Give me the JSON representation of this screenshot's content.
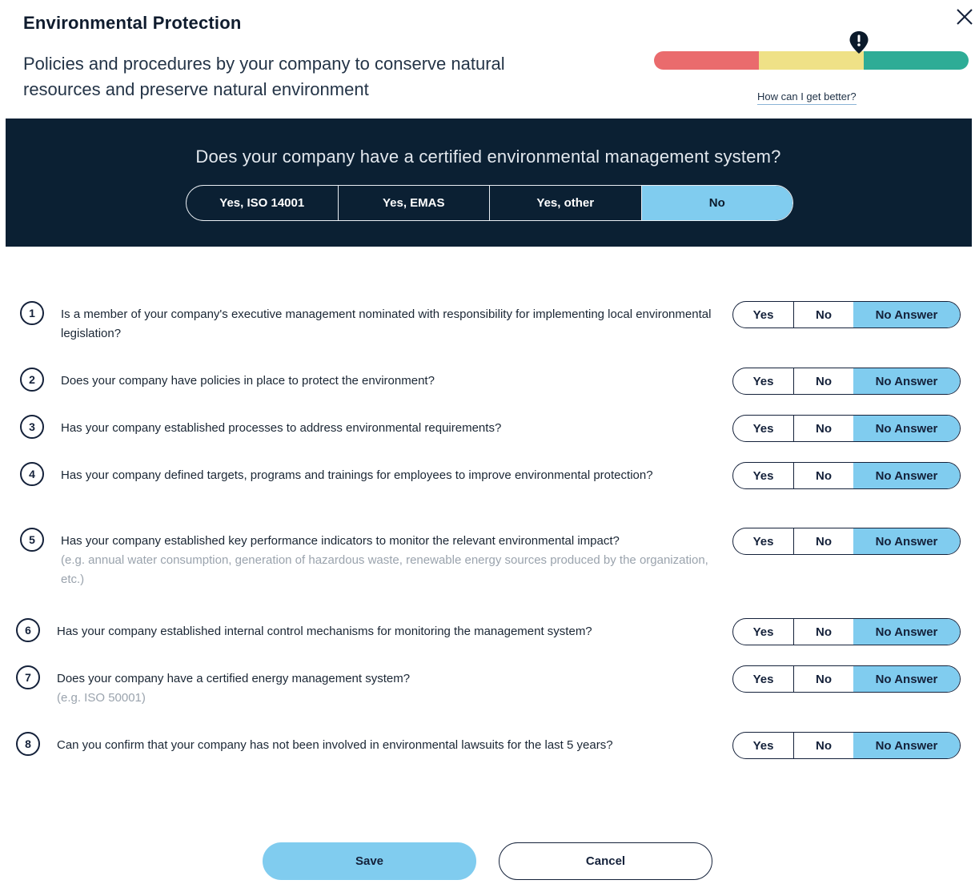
{
  "header": {
    "title": "Environmental Protection",
    "subtitle": "Policies and procedures by your company to conserve natural resources and preserve natural environment",
    "close_icon": "close-icon",
    "better_link": "How can I get better?"
  },
  "rating": {
    "segments": [
      {
        "name": "low",
        "color": "#ea6b6d",
        "fraction": 0.333
      },
      {
        "name": "medium",
        "color": "#efe187",
        "fraction": 0.333
      },
      {
        "name": "high",
        "color": "#2eac96",
        "fraction": 0.334
      }
    ],
    "marker_position": 0.65,
    "marker_icon": "warning-pin-icon",
    "marker_color": "#0b1a2b"
  },
  "certification": {
    "question": "Does your company have a certified environmental management system?",
    "options": [
      "Yes, ISO 14001",
      "Yes, EMAS",
      "Yes, other",
      "No"
    ],
    "selected": "No"
  },
  "questions": [
    {
      "number": "1",
      "text": "Is a member of your company's executive management nominated with responsibility for implementing local environmental legislation?",
      "hint": ""
    },
    {
      "number": "2",
      "text": "Does your company have policies in place to protect the environment?",
      "hint": ""
    },
    {
      "number": "3",
      "text": "Has your company established processes to address environmental requirements?",
      "hint": ""
    },
    {
      "number": "4",
      "text": "Has your company defined targets, programs and trainings for employees to improve environmental protection?",
      "hint": ""
    },
    {
      "number": "5",
      "text": "Has your company established key performance indicators to monitor the relevant environmental impact?",
      "hint": "(e.g. annual water consumption, generation of hazardous waste, renewable energy sources produced by the organization, etc.)"
    },
    {
      "number": "6",
      "text": "Has your company established internal control mechanisms for monitoring the management system?",
      "hint": ""
    },
    {
      "number": "7",
      "text": "Does your company have a certified energy management system?",
      "hint": "(e.g. ISO 50001)"
    },
    {
      "number": "8",
      "text": "Can you confirm that your company has not been involved in environmental lawsuits for the last 5 years?",
      "hint": ""
    }
  ],
  "answer_options": {
    "yes": "Yes",
    "no": "No",
    "no_answer": "No Answer"
  },
  "selected_answer": "No Answer",
  "colors": {
    "accent": "#80ccef",
    "banner": "#0b2033",
    "text": "#14213a"
  },
  "footer": {
    "save_label": "Save",
    "cancel_label": "Cancel"
  }
}
